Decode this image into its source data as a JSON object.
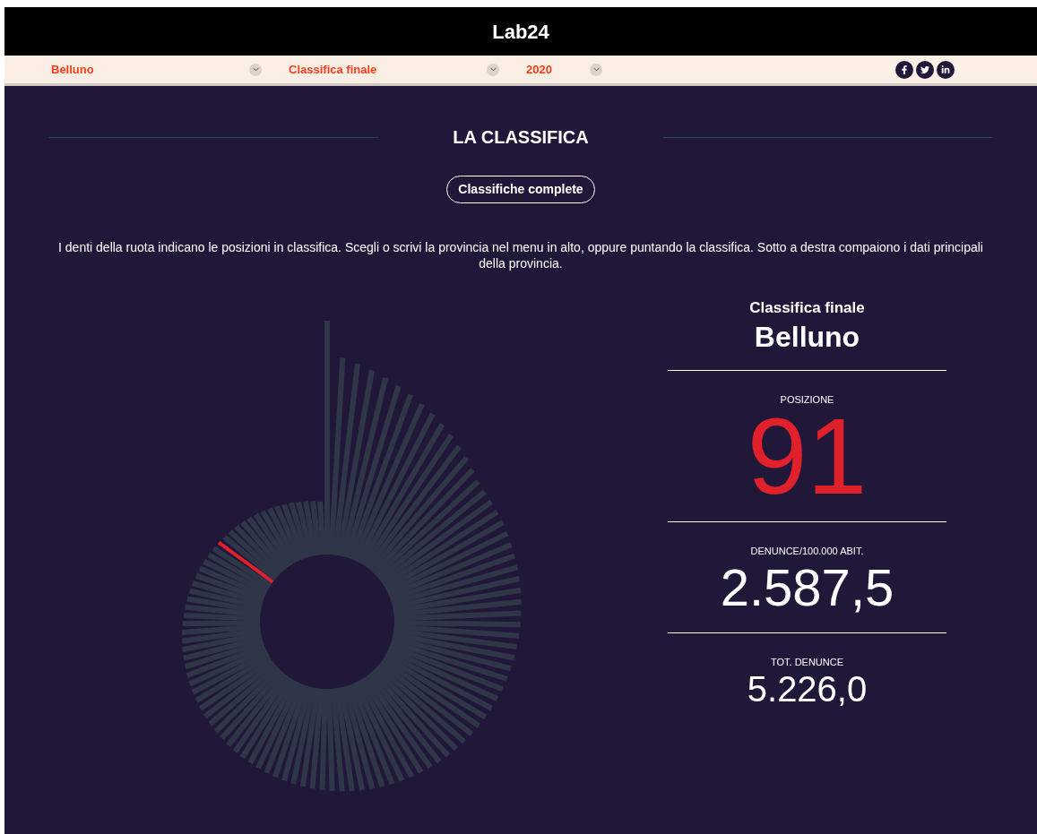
{
  "header": {
    "logo": "Lab24"
  },
  "filters": [
    {
      "value": "Belluno"
    },
    {
      "value": "Classifica finale"
    },
    {
      "value": "2020"
    }
  ],
  "section": {
    "title": "LA CLASSIFICA",
    "button": "Classifiche complete",
    "description": "I denti della ruota indicano le posizioni in classifica. Scegli o scrivi la provincia nel menu in alto, oppure puntando la classifica. Sotto a destra compaiono i dati principali della provincia."
  },
  "details": {
    "ranking": "Classifica finale",
    "province": "Belluno",
    "stats": [
      {
        "label": "POSIZIONE",
        "value": "91",
        "kind": "rank"
      },
      {
        "label": "DENUNCE/100.000 ABIT.",
        "value": "2.587,5",
        "kind": "large"
      },
      {
        "label": "TOT. DENUNCE",
        "value": "5.226,0",
        "kind": "light"
      }
    ]
  }
}
